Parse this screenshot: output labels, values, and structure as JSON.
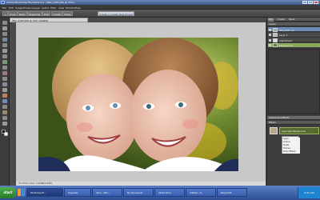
{
  "window": {
    "title": "Adobe Photoshop Elements 6.0 - [IMG_4183.JPG @ 33%]"
  },
  "menus": [
    "File",
    "Edit",
    "Image",
    "Enhance",
    "Layer",
    "Select",
    "Filter",
    "View",
    "Window",
    "Help"
  ],
  "options_bar": {
    "undo": "Undo",
    "redo": "Redo",
    "organizer": "Organizer",
    "mode_edit": "Edit",
    "mode_create": "Create",
    "share": "Share",
    "create_new": "Create a Create New Project"
  },
  "document": {
    "tab": "IMG_4183.JPG @ 33% (RGB/8)",
    "status": "33.33% | Doc: 2.63M/2.63M"
  },
  "panels": {
    "tabs": [
      "Edit",
      "Create",
      "Share"
    ],
    "layers_header": "Layers",
    "layers": [
      "IMG_4183 (2)",
      "Layer 1",
      "Adjustment",
      "Background"
    ],
    "effects_header": "Artwork and Effects",
    "effects_subheader": "Effects",
    "effects_menu_items": [
      "Apply",
      "Actions",
      "Styles",
      "Frames",
      "Photo Effects"
    ],
    "style_label": "Layer Style Backgrounds"
  },
  "taskbar": {
    "start": "start",
    "tasks": [
      "Photoshop El...",
      "Organizer",
      "Inbox - Micr...",
      "My Documents",
      "Adobe Phot...",
      "Untitled - P...",
      "Blog Draft..."
    ],
    "clock": "9:41 AM"
  },
  "colors": {
    "accent": "#3d5a8f",
    "panel": "#3d3d3d",
    "taskbar": "#2e4f94",
    "start": "#3a9a3a"
  }
}
